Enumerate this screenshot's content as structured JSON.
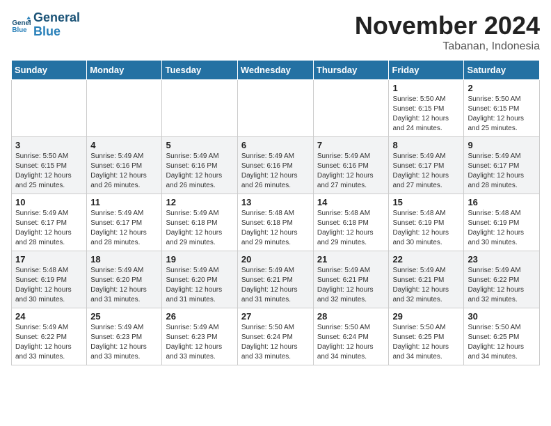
{
  "logo": {
    "line1": "General",
    "line2": "Blue"
  },
  "title": "November 2024",
  "subtitle": "Tabanan, Indonesia",
  "days_of_week": [
    "Sunday",
    "Monday",
    "Tuesday",
    "Wednesday",
    "Thursday",
    "Friday",
    "Saturday"
  ],
  "weeks": [
    [
      {
        "day": "",
        "info": ""
      },
      {
        "day": "",
        "info": ""
      },
      {
        "day": "",
        "info": ""
      },
      {
        "day": "",
        "info": ""
      },
      {
        "day": "",
        "info": ""
      },
      {
        "day": "1",
        "info": "Sunrise: 5:50 AM\nSunset: 6:15 PM\nDaylight: 12 hours and 24 minutes."
      },
      {
        "day": "2",
        "info": "Sunrise: 5:50 AM\nSunset: 6:15 PM\nDaylight: 12 hours and 25 minutes."
      }
    ],
    [
      {
        "day": "3",
        "info": "Sunrise: 5:50 AM\nSunset: 6:15 PM\nDaylight: 12 hours and 25 minutes."
      },
      {
        "day": "4",
        "info": "Sunrise: 5:49 AM\nSunset: 6:16 PM\nDaylight: 12 hours and 26 minutes."
      },
      {
        "day": "5",
        "info": "Sunrise: 5:49 AM\nSunset: 6:16 PM\nDaylight: 12 hours and 26 minutes."
      },
      {
        "day": "6",
        "info": "Sunrise: 5:49 AM\nSunset: 6:16 PM\nDaylight: 12 hours and 26 minutes."
      },
      {
        "day": "7",
        "info": "Sunrise: 5:49 AM\nSunset: 6:16 PM\nDaylight: 12 hours and 27 minutes."
      },
      {
        "day": "8",
        "info": "Sunrise: 5:49 AM\nSunset: 6:17 PM\nDaylight: 12 hours and 27 minutes."
      },
      {
        "day": "9",
        "info": "Sunrise: 5:49 AM\nSunset: 6:17 PM\nDaylight: 12 hours and 28 minutes."
      }
    ],
    [
      {
        "day": "10",
        "info": "Sunrise: 5:49 AM\nSunset: 6:17 PM\nDaylight: 12 hours and 28 minutes."
      },
      {
        "day": "11",
        "info": "Sunrise: 5:49 AM\nSunset: 6:17 PM\nDaylight: 12 hours and 28 minutes."
      },
      {
        "day": "12",
        "info": "Sunrise: 5:49 AM\nSunset: 6:18 PM\nDaylight: 12 hours and 29 minutes."
      },
      {
        "day": "13",
        "info": "Sunrise: 5:48 AM\nSunset: 6:18 PM\nDaylight: 12 hours and 29 minutes."
      },
      {
        "day": "14",
        "info": "Sunrise: 5:48 AM\nSunset: 6:18 PM\nDaylight: 12 hours and 29 minutes."
      },
      {
        "day": "15",
        "info": "Sunrise: 5:48 AM\nSunset: 6:19 PM\nDaylight: 12 hours and 30 minutes."
      },
      {
        "day": "16",
        "info": "Sunrise: 5:48 AM\nSunset: 6:19 PM\nDaylight: 12 hours and 30 minutes."
      }
    ],
    [
      {
        "day": "17",
        "info": "Sunrise: 5:48 AM\nSunset: 6:19 PM\nDaylight: 12 hours and 30 minutes."
      },
      {
        "day": "18",
        "info": "Sunrise: 5:49 AM\nSunset: 6:20 PM\nDaylight: 12 hours and 31 minutes."
      },
      {
        "day": "19",
        "info": "Sunrise: 5:49 AM\nSunset: 6:20 PM\nDaylight: 12 hours and 31 minutes."
      },
      {
        "day": "20",
        "info": "Sunrise: 5:49 AM\nSunset: 6:21 PM\nDaylight: 12 hours and 31 minutes."
      },
      {
        "day": "21",
        "info": "Sunrise: 5:49 AM\nSunset: 6:21 PM\nDaylight: 12 hours and 32 minutes."
      },
      {
        "day": "22",
        "info": "Sunrise: 5:49 AM\nSunset: 6:21 PM\nDaylight: 12 hours and 32 minutes."
      },
      {
        "day": "23",
        "info": "Sunrise: 5:49 AM\nSunset: 6:22 PM\nDaylight: 12 hours and 32 minutes."
      }
    ],
    [
      {
        "day": "24",
        "info": "Sunrise: 5:49 AM\nSunset: 6:22 PM\nDaylight: 12 hours and 33 minutes."
      },
      {
        "day": "25",
        "info": "Sunrise: 5:49 AM\nSunset: 6:23 PM\nDaylight: 12 hours and 33 minutes."
      },
      {
        "day": "26",
        "info": "Sunrise: 5:49 AM\nSunset: 6:23 PM\nDaylight: 12 hours and 33 minutes."
      },
      {
        "day": "27",
        "info": "Sunrise: 5:50 AM\nSunset: 6:24 PM\nDaylight: 12 hours and 33 minutes."
      },
      {
        "day": "28",
        "info": "Sunrise: 5:50 AM\nSunset: 6:24 PM\nDaylight: 12 hours and 34 minutes."
      },
      {
        "day": "29",
        "info": "Sunrise: 5:50 AM\nSunset: 6:25 PM\nDaylight: 12 hours and 34 minutes."
      },
      {
        "day": "30",
        "info": "Sunrise: 5:50 AM\nSunset: 6:25 PM\nDaylight: 12 hours and 34 minutes."
      }
    ]
  ]
}
